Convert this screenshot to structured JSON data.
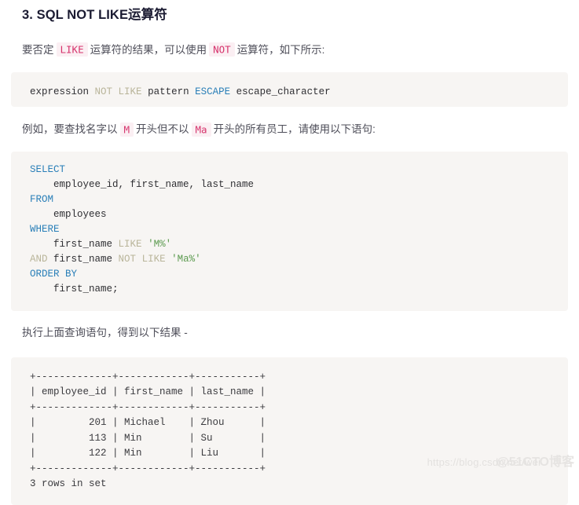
{
  "heading": {
    "text": "3. SQL NOT LIKE运算符"
  },
  "paragraph_1": {
    "before": "要否定",
    "code_1": "LIKE",
    "middle": "运算符的结果，可以使用",
    "code_2": "NOT",
    "after": "运算符，如下所示:"
  },
  "syntax_block": {
    "tokens": [
      {
        "text": "expression ",
        "type": "plain"
      },
      {
        "text": "NOT",
        "type": "keyword-dim"
      },
      {
        "text": " ",
        "type": "plain"
      },
      {
        "text": "LIKE",
        "type": "keyword-dim"
      },
      {
        "text": " pattern ",
        "type": "plain"
      },
      {
        "text": "ESCAPE",
        "type": "keyword"
      },
      {
        "text": " escape_character",
        "type": "plain"
      }
    ],
    "plain_text": "expression NOT LIKE pattern ESCAPE escape_character"
  },
  "paragraph_2": {
    "before": "例如，要查找名字以",
    "code_1": "M",
    "middle": "开头但不以",
    "code_2": "Ma",
    "after": "开头的所有员工，请使用以下语句:"
  },
  "query_block": {
    "lines": [
      [
        {
          "text": "SELECT",
          "type": "keyword"
        }
      ],
      [
        {
          "text": "    employee_id, first_name, last_name",
          "type": "plain"
        }
      ],
      [
        {
          "text": "FROM",
          "type": "keyword"
        }
      ],
      [
        {
          "text": "    employees",
          "type": "plain"
        }
      ],
      [
        {
          "text": "WHERE",
          "type": "keyword"
        }
      ],
      [
        {
          "text": "    first_name ",
          "type": "plain"
        },
        {
          "text": "LIKE",
          "type": "keyword-dim"
        },
        {
          "text": " ",
          "type": "plain"
        },
        {
          "text": "'M%'",
          "type": "string"
        }
      ],
      [
        {
          "text": "AND",
          "type": "keyword-dim"
        },
        {
          "text": " first_name ",
          "type": "plain"
        },
        {
          "text": "NOT",
          "type": "keyword-dim"
        },
        {
          "text": " ",
          "type": "plain"
        },
        {
          "text": "LIKE",
          "type": "keyword-dim"
        },
        {
          "text": " ",
          "type": "plain"
        },
        {
          "text": "'Ma%'",
          "type": "string"
        }
      ],
      [
        {
          "text": "ORDER BY",
          "type": "keyword"
        }
      ],
      [
        {
          "text": "    first_name;",
          "type": "plain"
        }
      ]
    ],
    "plain_text": "SELECT\n    employee_id, first_name, last_name\nFROM\n    employees\nWHERE\n    first_name LIKE 'M%'\nAND first_name NOT LIKE 'Ma%'\nORDER BY\n    first_name;"
  },
  "paragraph_3": {
    "text": "执行上面查询语句，得到以下结果 -"
  },
  "result_block": {
    "columns": [
      "employee_id",
      "first_name",
      "last_name"
    ],
    "rows": [
      {
        "employee_id": "201",
        "first_name": "Michael",
        "last_name": "Zhou"
      },
      {
        "employee_id": "113",
        "first_name": "Min",
        "last_name": "Su"
      },
      {
        "employee_id": "122",
        "first_name": "Min",
        "last_name": "Liu"
      }
    ],
    "footer": "3 rows in set",
    "ascii_lines": [
      "+-------------+------------+-----------+",
      "| employee_id | first_name | last_name |",
      "+-------------+------------+-----------+",
      "|         201 | Michael    | Zhou      |",
      "|         113 | Min        | Su        |",
      "|         122 | Min        | Liu       |",
      "+-------------+------------+-----------+",
      "3 rows in set"
    ],
    "plain_text": "+-------------+------------+-----------+\n| employee_id | first_name | last_name |\n+-------------+------------+-----------+\n|         201 | Michael    | Zhou      |\n|         113 | Min        | Su        |\n|         122 | Min        | Liu       |\n+-------------+------------+-----------+\n3 rows in set"
  },
  "watermark": {
    "url": "https://blog.csdn.net/wei",
    "brand": "@51CTO博客"
  },
  "colors": {
    "heading": "#1b1b32",
    "body_text": "#4f4f5a",
    "inline_code_text": "#d6336c",
    "inline_code_bg": "#fbeff3",
    "code_bg": "#f7f5f3",
    "sql_keyword": "#2a7fb8",
    "sql_keyword_dim": "#b9b59a",
    "sql_string": "#5b9a4e",
    "sql_plain": "#2f2f33",
    "watermark": "#e3e1df"
  }
}
